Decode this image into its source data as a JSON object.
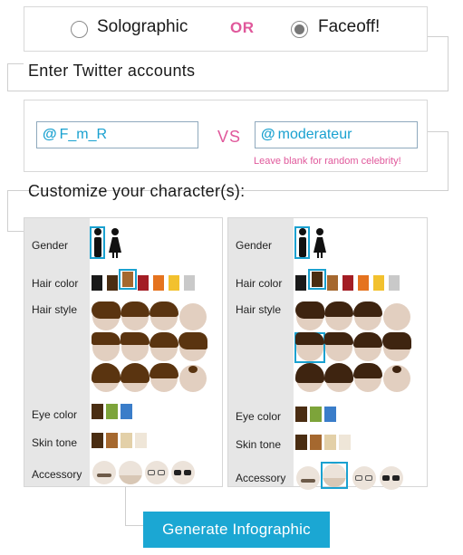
{
  "mode": {
    "options": [
      {
        "label": "Solographic",
        "checked": false
      },
      {
        "label": "Faceoff!",
        "checked": true
      }
    ],
    "or_label": "OR"
  },
  "twitter": {
    "title": "Enter Twitter accounts",
    "at_symbol": "@",
    "account1": "F_m_R",
    "account2": "moderateur",
    "vs_label": "VS",
    "hint": "Leave blank for random celebrity!"
  },
  "customize": {
    "title": "Customize your character(s):",
    "labels": {
      "gender": "Gender",
      "hair_color": "Hair color",
      "hair_style": "Hair style",
      "eye_color": "Eye color",
      "skin_tone": "Skin tone",
      "accessory": "Accessory"
    },
    "colors": {
      "hair": [
        "#1a1a1a",
        "#4a2d12",
        "#a5682f",
        "#a31d24",
        "#e5731f",
        "#f2c12e",
        "#c9c9c9"
      ],
      "eye": [
        "#4a2d12",
        "#7da43a",
        "#3a7dc9"
      ],
      "skin": [
        "#4a2d12",
        "#a5682f",
        "#e3d0a8",
        "#efe6d8"
      ],
      "accent": "#1aa1d0",
      "pink": "#e0589b"
    },
    "character1": {
      "gender_selected": "male",
      "hair_color_selected": 2,
      "hair_style_selected": null,
      "accessory_selected": null
    },
    "character2": {
      "gender_selected": "male",
      "hair_color_selected": 1,
      "hair_style_selected": 4,
      "accessory_selected": 1
    }
  },
  "generate_label": "Generate Infographic"
}
